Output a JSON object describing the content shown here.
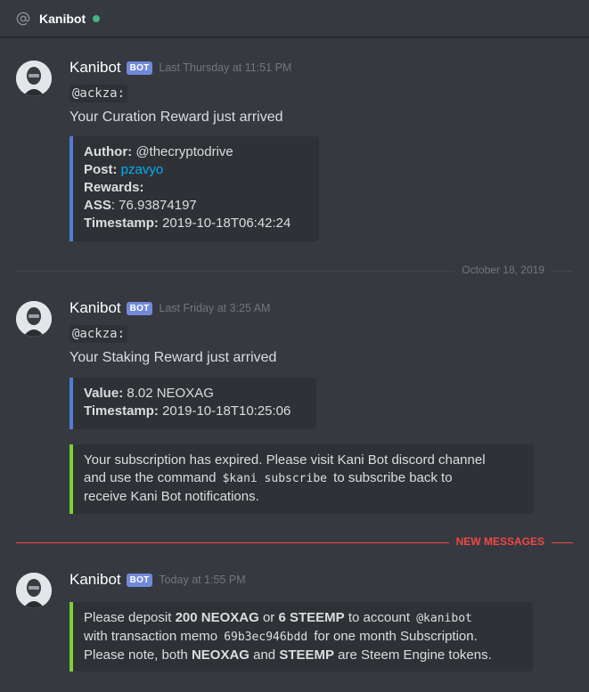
{
  "channel": {
    "name": "Kanibot",
    "status_color": "#43b581"
  },
  "colors": {
    "bot_tag": "#7289da",
    "embed_blue": "#4f7ed9",
    "embed_green": "#7ad133",
    "new_messages": "#f04747",
    "divider": "#42454a"
  },
  "messages": [
    {
      "author": "Kanibot",
      "bot_tag": "BOT",
      "timestamp": "Last Thursday at 11:51 PM",
      "mention": "@ackza:",
      "text": "Your Curation Reward just arrived",
      "embed": {
        "author_label": "Author:",
        "author_value": " @thecryptodrive",
        "post_label": "Post:",
        "post_value": "pzavyo",
        "rewards_label": "Rewards:",
        "ass_label": "ASS",
        "ass_value": ": 76.93874197",
        "timestamp_label": "Timestamp:",
        "timestamp_value": " 2019-10-18T06:42:24"
      }
    },
    {
      "author": "Kanibot",
      "bot_tag": "BOT",
      "timestamp": "Last Friday at 3:25 AM",
      "mention": "@ackza:",
      "text": "Your Staking Reward just arrived",
      "embed": {
        "value_label": "Value:",
        "value_value": " 8.02 NEOXAG",
        "timestamp_label": "Timestamp:",
        "timestamp_value": " 2019-10-18T10:25:06"
      },
      "notice": {
        "line1": "Your subscription has expired. Please visit Kani Bot discord channel",
        "line2_pre": "and use the command ",
        "line2_code": "$kani subscribe",
        "line2_post": " to subscribe back to",
        "line3": "receive Kani Bot notifications."
      }
    },
    {
      "author": "Kanibot",
      "bot_tag": "BOT",
      "timestamp": "Today at 1:55 PM",
      "embed": {
        "l1_a": "Please deposit ",
        "l1_b": "200 NEOXAG",
        "l1_c": " or ",
        "l1_d": "6 STEEMP",
        "l1_e": " to account ",
        "l1_code": "@kanibot",
        "l2_a": "with transaction memo ",
        "l2_code": "69b3ec946bdd",
        "l2_b": " for one month Subscription.",
        "l3_a": "Please note, both ",
        "l3_b": "NEOXAG",
        "l3_c": " and ",
        "l3_d": "STEEMP",
        "l3_e": " are Steem Engine tokens."
      }
    }
  ],
  "dividers": {
    "date": "October 18, 2019",
    "new_messages": "NEW MESSAGES"
  }
}
